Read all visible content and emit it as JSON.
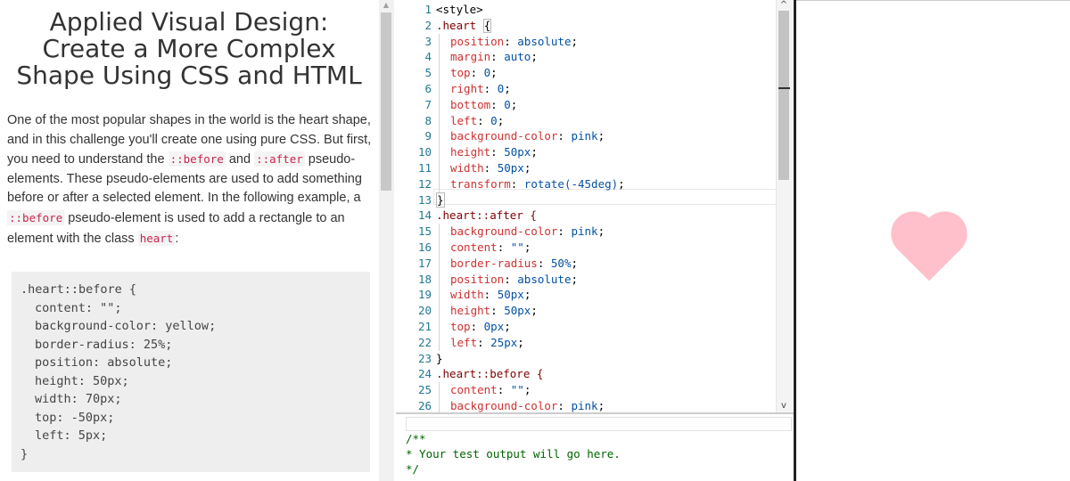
{
  "challenge": {
    "title": "Applied Visual Design: Create a More Complex Shape Using CSS and HTML",
    "description": [
      {
        "type": "text",
        "value": "One of the most popular shapes in the world is the heart shape, and in this challenge you'll create one using pure CSS. But first, you need to understand the "
      },
      {
        "type": "code",
        "value": "::before"
      },
      {
        "type": "text",
        "value": " and "
      },
      {
        "type": "code",
        "value": "::after"
      },
      {
        "type": "text",
        "value": " pseudo-elements. These pseudo-elements are used to add something before or after a selected element. In the following example, a "
      },
      {
        "type": "code",
        "value": "::before"
      },
      {
        "type": "text",
        "value": " pseudo-element is used to add a rectangle to an element with the class "
      },
      {
        "type": "code",
        "value": "heart"
      },
      {
        "type": "text",
        "value": ":"
      }
    ],
    "example_code": [
      {
        "text": ".heart::before {",
        "indent": false
      },
      {
        "text": "content: \"\";",
        "indent": true
      },
      {
        "text": "background-color: yellow;",
        "indent": true
      },
      {
        "text": "border-radius: 25%;",
        "indent": true
      },
      {
        "text": "position: absolute;",
        "indent": true
      },
      {
        "text": "height: 50px;",
        "indent": true
      },
      {
        "text": "width: 70px;",
        "indent": true
      },
      {
        "text": "top: -50px;",
        "indent": true
      },
      {
        "text": "left: 5px;",
        "indent": true
      },
      {
        "text": "}",
        "indent": false
      }
    ]
  },
  "editor": {
    "lines": [
      {
        "n": "1",
        "text": "<style>",
        "nested": false,
        "kind": "tag"
      },
      {
        "n": "2",
        "text": ".heart {",
        "nested": false,
        "kind": "selector",
        "bracket_highlight": true
      },
      {
        "n": "3",
        "prop": "position",
        "val": "absolute",
        "nested": true
      },
      {
        "n": "4",
        "prop": "margin",
        "val": "auto",
        "nested": true
      },
      {
        "n": "5",
        "prop": "top",
        "val": "0",
        "nested": true
      },
      {
        "n": "6",
        "prop": "right",
        "val": "0",
        "nested": true
      },
      {
        "n": "7",
        "prop": "bottom",
        "val": "0",
        "nested": true
      },
      {
        "n": "8",
        "prop": "left",
        "val": "0",
        "nested": true
      },
      {
        "n": "9",
        "prop": "background-color",
        "val": "pink",
        "nested": true
      },
      {
        "n": "10",
        "prop": "height",
        "val": "50px",
        "nested": true
      },
      {
        "n": "11",
        "prop": "width",
        "val": "50px",
        "nested": true
      },
      {
        "n": "12",
        "prop": "transform",
        "val": "rotate(-45deg)",
        "nested": true
      },
      {
        "n": "13",
        "text": "}",
        "nested": false,
        "kind": "close",
        "bracket_highlight": true
      },
      {
        "n": "14",
        "text": ".heart::after {",
        "nested": false,
        "kind": "selector"
      },
      {
        "n": "15",
        "prop": "background-color",
        "val": "pink",
        "nested": true
      },
      {
        "n": "16",
        "prop": "content",
        "val": "\"\"",
        "nested": true
      },
      {
        "n": "17",
        "prop": "border-radius",
        "val": "50%",
        "nested": true
      },
      {
        "n": "18",
        "prop": "position",
        "val": "absolute",
        "nested": true
      },
      {
        "n": "19",
        "prop": "width",
        "val": "50px",
        "nested": true
      },
      {
        "n": "20",
        "prop": "height",
        "val": "50px",
        "nested": true
      },
      {
        "n": "21",
        "prop": "top",
        "val": "0px",
        "nested": true
      },
      {
        "n": "22",
        "prop": "left",
        "val": "25px",
        "nested": true
      },
      {
        "n": "23",
        "text": "}",
        "nested": false,
        "kind": "close"
      },
      {
        "n": "24",
        "text": ".heart::before {",
        "nested": false,
        "kind": "selector"
      },
      {
        "n": "25",
        "prop": "content",
        "val": "\"\"",
        "nested": true
      },
      {
        "n": "26",
        "prop": "background-color",
        "val": "pink",
        "nested": true
      }
    ]
  },
  "test_output": {
    "text": "/**\n* Your test output will go here.\n*/"
  },
  "preview": {
    "heart_color": "#ffc0cb"
  },
  "icons": {
    "left_scroll_up": "▲",
    "editor_scroll_up": "^",
    "editor_scroll_down": "v"
  }
}
